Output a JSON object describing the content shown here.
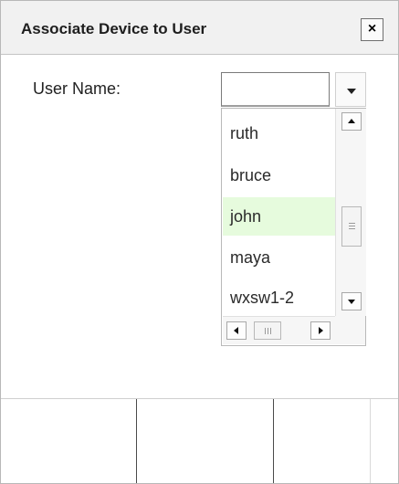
{
  "dialog": {
    "title": "Associate Device to User",
    "close_label": "×"
  },
  "form": {
    "user_name_label": "User Name:",
    "user_name_value": ""
  },
  "dropdown": {
    "options": [
      "ruth",
      "bruce",
      "john",
      "maya",
      "wxsw1-2"
    ],
    "highlighted": "john"
  },
  "icons": {
    "dropdown_arrow": "chevron-down-icon",
    "scroll_up": "scroll-up-arrow-icon",
    "scroll_down": "scroll-down-arrow-icon",
    "scroll_left": "scroll-left-arrow-icon",
    "scroll_right": "scroll-right-arrow-icon",
    "close": "close-icon"
  },
  "colors": {
    "highlight": "#e6fbdd",
    "titlebar": "#f1f1f1"
  }
}
